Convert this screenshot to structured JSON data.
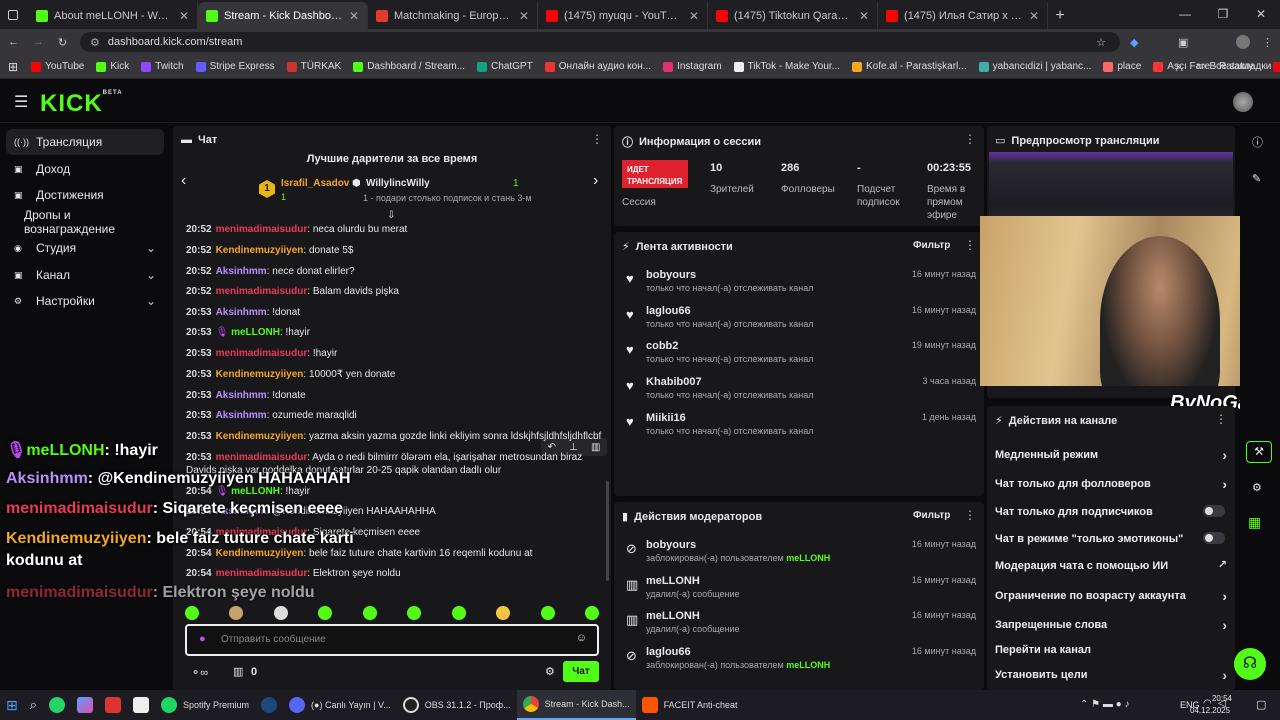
{
  "browser": {
    "tabs": [
      {
        "title": "About meLLONH - Watch Live o",
        "color": "#53fc18"
      },
      {
        "title": "Stream - Kick Dashboard",
        "color": "#53fc18",
        "active": true
      },
      {
        "title": "Matchmaking - Europe 5v5 Qu",
        "color": "#e23b2e"
      },
      {
        "title": "(1475) myuqu - YouTube",
        "color": "#ff0000"
      },
      {
        "title": "(1475) Tiktokun Qaranlıq Üzü",
        "color": "#ff0000"
      },
      {
        "title": "(1475) Илья Сатир x Юрий Га",
        "color": "#ff0000"
      }
    ],
    "url": "dashboard.kick.com/stream",
    "bookmarks": [
      "YouTube",
      "Kick",
      "Twitch",
      "Stripe Express",
      "TÜRKAK",
      "Dashboard / Stream...",
      "ChatGPT",
      "Онлайн аудио кон...",
      "Instagram",
      "TikTok - Make Your...",
      "Kofe.al - Parastişkarl...",
      "yabancıdizi | yabanc...",
      "place",
      "Aşçı Fare - Ratatuy...",
      "Netflix"
    ],
    "all_bookmarks": "Все закладки"
  },
  "kick": {
    "logo": "KICK",
    "beta": "BETA"
  },
  "sidebar": [
    {
      "label": "Трансляция",
      "icon": "broadcast-icon",
      "active": true
    },
    {
      "label": "Доход",
      "icon": "income-icon"
    },
    {
      "label": "Достижения",
      "icon": "trophy-icon"
    },
    {
      "label": "Дропы и вознаграждение",
      "icon": ""
    },
    {
      "label": "Студия",
      "icon": "studio-icon",
      "chev": "⌄"
    },
    {
      "label": "Канал",
      "icon": "channel-icon",
      "chev": "⌄"
    },
    {
      "label": "Настройки",
      "icon": "settings-icon",
      "chev": "⌄"
    }
  ],
  "chat": {
    "title": "Чат",
    "gifters_title": "Лучшие дарители за все время",
    "gifter1": {
      "rank": "1",
      "name": "Israfil_Asadov",
      "count": "1"
    },
    "gifter2": {
      "name": "WillylincWilly",
      "count": "1"
    },
    "gift_note": "1 - подари столько подписок и стань 3-м",
    "messages": [
      {
        "t": "20:52",
        "u": "menimadimaisudur",
        "c": "u1",
        "m": ": neca olurdu bu merat"
      },
      {
        "t": "20:52",
        "u": "Kendinemuzyiiyen",
        "c": "u2",
        "m": ": donate 5$"
      },
      {
        "t": "20:52",
        "u": "Aksinhmm",
        "c": "u3",
        "m": ": nece donat elirler?"
      },
      {
        "t": "20:52",
        "u": "menimadimaisudur",
        "c": "u1",
        "m": ": Balam davids pişka"
      },
      {
        "t": "20:53",
        "u": "Aksinhmm",
        "c": "u3",
        "m": ": !donat"
      },
      {
        "t": "20:53",
        "u": "meLLONH",
        "c": "u4",
        "m": ": !hayir"
      },
      {
        "t": "20:53",
        "u": "menimadimaisudur",
        "c": "u1",
        "m": ": !hayir"
      },
      {
        "t": "20:53",
        "u": "Kendinemuzyiiyen",
        "c": "u2",
        "m": ": 10000₹ yen donate"
      },
      {
        "t": "20:53",
        "u": "Aksinhmm",
        "c": "u3",
        "m": ": !donate"
      },
      {
        "t": "20:53",
        "u": "Aksinhmm",
        "c": "u3",
        "m": ": ozumede maraqlidi"
      },
      {
        "t": "20:53",
        "u": "Kendinemuzyiiyen",
        "c": "u2",
        "m": ": yazma aksin yazma gozde linki ekliyim sonra ldskjhfsjldhfsljdhflcbf"
      },
      {
        "t": "20:53",
        "u": "menimadimaisudur",
        "c": "u1",
        "m": ": Ayda o nedi bilmirrr ölərəm ela, işarişahar metrosundan biraz"
      },
      {
        "t": "",
        "u": "",
        "c": "u1",
        "m": "Davids pişka var poddelka donut satırlar 20-25 qapik olandan dadlı olur"
      },
      {
        "t": "20:54",
        "u": "meLLONH",
        "c": "u4",
        "m": ": !hayir"
      },
      {
        "t": "20:54",
        "u": "Aksinhmm",
        "c": "u3",
        "m": ": @Kendinemuzyiiyen HAHAAHAHHA"
      },
      {
        "t": "20:54",
        "u": "menimadimaisudur",
        "c": "u1",
        "m": ": Siqarete keçmisen eeee"
      },
      {
        "t": "20:54",
        "u": "Kendinemuzyiiyen",
        "c": "u2",
        "m": ": bele faiz tuture chate kartivin 16 reqemli kodunu at"
      },
      {
        "t": "20:54",
        "u": "menimadimaisudur",
        "c": "u1",
        "m": ": Elektron şeye noldu"
      }
    ],
    "input_placeholder": "Отправить сообщение",
    "send_label": "Чат",
    "count": "0"
  },
  "overlay": [
    {
      "u": "meLLONH",
      "c": "u4",
      "m": ": !hayir"
    },
    {
      "u": "Aksinhmm",
      "c": "u3",
      "m": ": @Kendinemuzyiiyen HAHAAHAH"
    },
    {
      "u": "menimadimaisudur",
      "c": "u1",
      "m": ": Siqarete keçmisen eeee"
    },
    {
      "u": "Kendinemuzyiiyen",
      "c": "u2",
      "m": ": bele faiz tuture chate karti"
    },
    {
      "u": "",
      "c": "",
      "m": "kodunu at"
    },
    {
      "u": "menimadimaisudur",
      "c": "u1",
      "m": ": Elektron şeye noldu"
    }
  ],
  "session": {
    "title": "Информация о сессии",
    "live": "ИДЕТ ТРАНСЛЯЦИЯ",
    "session_label": "Сессия",
    "stats": [
      {
        "value": "10",
        "label": "Зрителей"
      },
      {
        "value": "286",
        "label": "Фолловеры"
      },
      {
        "value": "-",
        "label": "Подсчет подписок"
      },
      {
        "value": "00:23:55",
        "label": "Время в прямом эфире"
      }
    ]
  },
  "activity": {
    "title": "Лента активности",
    "filter": "Фильтр",
    "items": [
      {
        "name": "bobyours",
        "desc": "только что начал(-а) отслеживать канал",
        "time": "16 минут назад"
      },
      {
        "name": "laglou66",
        "desc": "только что начал(-а) отслеживать канал",
        "time": "16 минут назад"
      },
      {
        "name": "cobb2",
        "desc": "только что начал(-а) отслеживать канал",
        "time": "19 минут назад"
      },
      {
        "name": "Khabib007",
        "desc": "только что начал(-а) отслеживать канал",
        "time": "3 часа назад"
      },
      {
        "name": "Miikii16",
        "desc": "только что начал(-а) отслеживать канал",
        "time": "1 день назад"
      }
    ]
  },
  "mod": {
    "title": "Действия модераторов",
    "filter": "Фильтр",
    "items": [
      {
        "name": "bobyours",
        "desc": "заблокирован(-а) пользователем",
        "who": "meLLONH",
        "time": "16 минут назад",
        "icon": "ban-icon"
      },
      {
        "name": "meLLONH",
        "desc": "удалил(-а) сообщение",
        "who": "",
        "time": "16 минут назад",
        "icon": "trash-icon"
      },
      {
        "name": "meLLONH",
        "desc": "удалил(-а) сообщение",
        "who": "",
        "time": "16 минут назад",
        "icon": "trash-icon"
      },
      {
        "name": "laglou66",
        "desc": "заблокирован(-а) пользователем",
        "who": "meLLONH",
        "time": "16 минут назад",
        "icon": "ban-icon"
      }
    ]
  },
  "preview": {
    "title": "Предпросмотр трансляции",
    "watermark": "ByNoGame"
  },
  "channel_actions": {
    "title": "Действия на канале",
    "items": [
      {
        "label": "Медленный режим",
        "type": "arrow"
      },
      {
        "label": "Чат только для фолловеров",
        "type": "arrow"
      },
      {
        "label": "Чат только для подписчиков",
        "type": "toggle"
      },
      {
        "label": "Чат в режиме \"только эмотиконы\"",
        "type": "toggle"
      },
      {
        "label": "Модерация чата с помощью ИИ",
        "type": "ext"
      },
      {
        "label": "Ограничение по возрасту аккаунта",
        "type": "arrow"
      },
      {
        "label": "Запрещенные слова",
        "type": "arrow"
      },
      {
        "label": "Перейти на канал",
        "type": "none"
      },
      {
        "label": "Установить цели",
        "type": "arrow"
      }
    ]
  },
  "taskbar": {
    "items": [
      "Spotify Premium",
      "(●) Canlı Yayın | V...",
      "OBS 31.1.2 - Проф...",
      "Stream - Kick Dash...",
      "FACEIT Anti-cheat"
    ],
    "lang": "ENG",
    "time": "20:54",
    "date": "04.12.2025"
  }
}
